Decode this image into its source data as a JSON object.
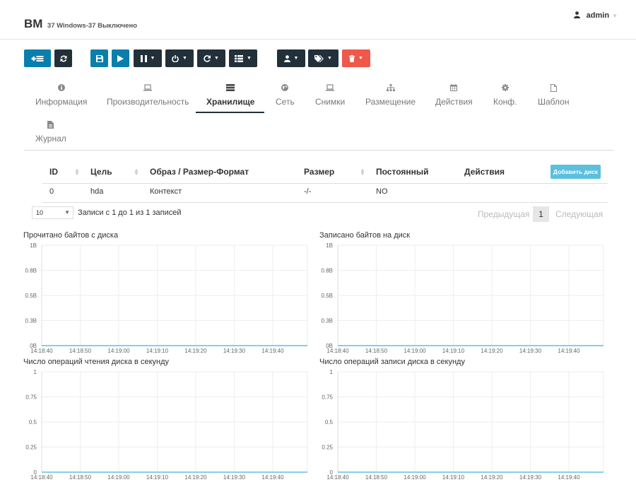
{
  "header": {
    "title": "ВМ",
    "subtitle": "37 Windows-37 Выключено",
    "user": "admin"
  },
  "toolbar": {
    "buttons": [
      {
        "name": "back-button",
        "icon": "back-list-icon",
        "color": "#0b7fac"
      },
      {
        "name": "refresh-button",
        "icon": "refresh-icon",
        "color": "#22303a"
      },
      {
        "name": "save-button",
        "icon": "save-icon",
        "color": "#0b7fac"
      },
      {
        "name": "play-button",
        "icon": "play-icon",
        "color": "#0b7fac"
      },
      {
        "name": "pause-dropdown",
        "icon": "pause-icon",
        "color": "#22303a"
      },
      {
        "name": "power-dropdown",
        "icon": "power-icon",
        "color": "#22303a"
      },
      {
        "name": "reboot-dropdown",
        "icon": "reboot-icon",
        "color": "#22303a"
      },
      {
        "name": "list-dropdown",
        "icon": "list-icon",
        "color": "#22303a"
      },
      {
        "name": "user-dropdown",
        "icon": "user-icon",
        "color": "#22303a"
      },
      {
        "name": "tag-dropdown",
        "icon": "tag-icon",
        "color": "#22303a"
      },
      {
        "name": "delete-dropdown",
        "icon": "trash-icon",
        "color": "#f0584a"
      }
    ]
  },
  "tabs": [
    {
      "label": "Информация",
      "icon": "info-icon"
    },
    {
      "label": "Производительность",
      "icon": "laptop-icon"
    },
    {
      "label": "Хранилище",
      "icon": "storage-icon",
      "active": true
    },
    {
      "label": "Сеть",
      "icon": "globe-icon"
    },
    {
      "label": "Снимки",
      "icon": "laptop-icon"
    },
    {
      "label": "Размещение",
      "icon": "sitemap-icon"
    },
    {
      "label": "Действия",
      "icon": "calendar-icon"
    },
    {
      "label": "Конф.",
      "icon": "gear-icon"
    },
    {
      "label": "Шаблон",
      "icon": "file-icon"
    },
    {
      "label": "Журнал",
      "icon": "file-text-icon"
    }
  ],
  "table": {
    "headers": [
      "ID",
      "Цель",
      "Образ / Размер-Формат",
      "Размер",
      "Постоянный",
      "Действия"
    ],
    "add_button": "Добавить диск",
    "rows": [
      [
        "0",
        "hda",
        "Контекст",
        "-/-",
        "NO",
        ""
      ]
    ]
  },
  "pagination": {
    "page_length": "10",
    "info": "Записи с 1 до 1 из 1 записей",
    "prev": "Предыдущая",
    "current": "1",
    "next": "Следующая"
  },
  "chart_data": [
    {
      "type": "line",
      "title": "Прочитано байтов с диска",
      "y_ticks": [
        "1B",
        "0.8B",
        "0.5B",
        "0.3B",
        "0B"
      ],
      "x_ticks": [
        "14:18:40",
        "14:18:50",
        "14:19:00",
        "14:19:10",
        "14:19:20",
        "14:19:30",
        "14:19:40"
      ],
      "ylim": [
        0,
        1
      ],
      "series": [
        {
          "values": [
            0,
            0,
            0,
            0,
            0,
            0,
            0
          ],
          "color": "#5bc0de"
        }
      ]
    },
    {
      "type": "line",
      "title": "Записано байтов на диск",
      "y_ticks": [
        "1B",
        "0.8B",
        "0.5B",
        "0.3B",
        "0B"
      ],
      "x_ticks": [
        "14:18:40",
        "14:18:50",
        "14:19:00",
        "14:19:10",
        "14:19:20",
        "14:19:30",
        "14:19:40"
      ],
      "ylim": [
        0,
        1
      ],
      "series": [
        {
          "values": [
            0,
            0,
            0,
            0,
            0,
            0,
            0
          ],
          "color": "#5bc0de"
        }
      ]
    },
    {
      "type": "line",
      "title": "Число операций чтения диска в секунду",
      "y_ticks": [
        "1",
        "0.75",
        "0.5",
        "0.25",
        "0"
      ],
      "x_ticks": [
        "14:18:40",
        "14:18:50",
        "14:19:00",
        "14:19:10",
        "14:19:20",
        "14:19:30",
        "14:19:40"
      ],
      "ylim": [
        0,
        1
      ],
      "series": [
        {
          "values": [
            0,
            0,
            0,
            0,
            0,
            0,
            0
          ],
          "color": "#5bc0de"
        }
      ]
    },
    {
      "type": "line",
      "title": "Число операций записи диска в секунду",
      "y_ticks": [
        "1",
        "0.75",
        "0.5",
        "0.25",
        "0"
      ],
      "x_ticks": [
        "14:18:40",
        "14:18:50",
        "14:19:00",
        "14:19:10",
        "14:19:20",
        "14:19:30",
        "14:19:40"
      ],
      "ylim": [
        0,
        1
      ],
      "series": [
        {
          "values": [
            0,
            0,
            0,
            0,
            0,
            0,
            0
          ],
          "color": "#5bc0de"
        }
      ]
    }
  ]
}
